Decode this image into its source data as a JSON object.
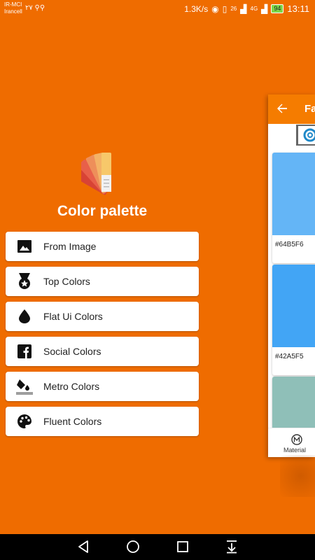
{
  "status_bar": {
    "carrier_line1": "IR-MCI",
    "carrier_line2": "Irancell",
    "left_indicator": "۲۷",
    "speed": "1.3K/s",
    "net1": "26",
    "net2": "4G",
    "battery": "94",
    "time": "13:11"
  },
  "app": {
    "title": "Color palette",
    "logo_icon": "palette-swatch-icon"
  },
  "menu": [
    {
      "label": "From Image",
      "icon": "image-icon"
    },
    {
      "label": "Top Colors",
      "icon": "medal-icon"
    },
    {
      "label": "Flat Ui Colors",
      "icon": "drop-icon"
    },
    {
      "label": "Social Colors",
      "icon": "facebook-icon"
    },
    {
      "label": "Metro Colors",
      "icon": "paint-bucket-icon"
    },
    {
      "label": "Fluent Colors",
      "icon": "palette-icon"
    }
  ],
  "preview": {
    "toolbar_title": "Fa",
    "cards": [
      {
        "hex": "#64B5F6",
        "color": "#64B5F6"
      },
      {
        "hex": "#42A5F5",
        "color": "#42A5F5"
      },
      {
        "hex": "",
        "color": "#8FBFB8"
      }
    ],
    "bottom_label": "Material"
  },
  "colors": {
    "background": "#EF6C00",
    "toolbar": "#F57C00"
  }
}
